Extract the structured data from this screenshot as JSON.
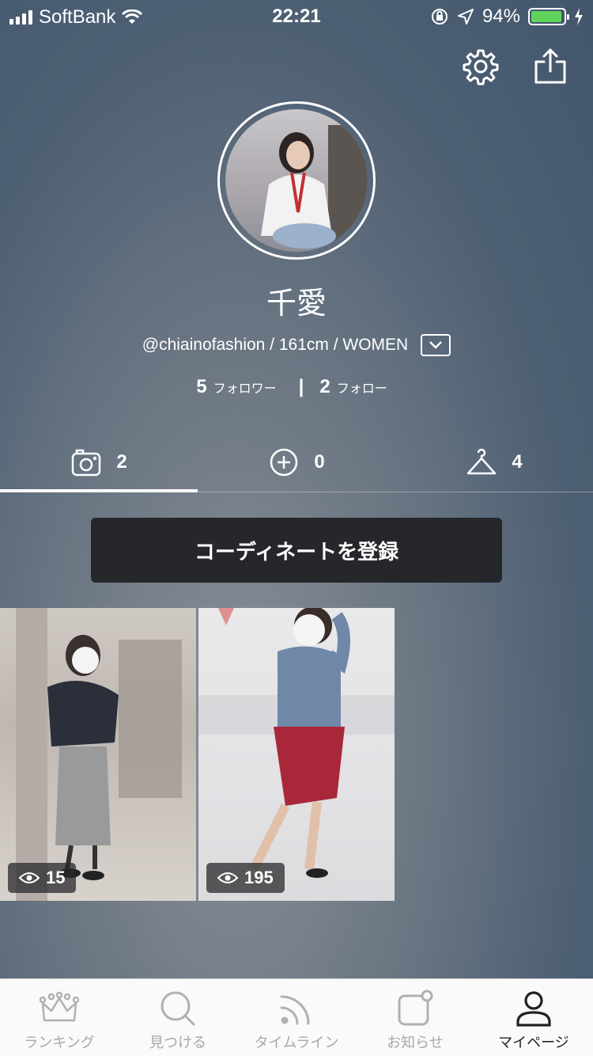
{
  "status_bar": {
    "carrier": "SoftBank",
    "time": "22:21",
    "battery": "94%",
    "battery_level": 0.94,
    "battery_color": "#5fd35a"
  },
  "header": {
    "settings_icon": "gear-icon",
    "share_icon": "share-icon"
  },
  "profile": {
    "name": "千愛",
    "meta": "@chiainofashion / 161cm / WOMEN",
    "followers_count": "5",
    "followers_label": "フォロワー",
    "following_count": "2",
    "following_label": "フォロー",
    "separator": "|"
  },
  "tabs": [
    {
      "icon": "camera-icon",
      "count": "2"
    },
    {
      "icon": "plus-circle-icon",
      "count": "0"
    },
    {
      "icon": "hanger-icon",
      "count": "4"
    }
  ],
  "register_button": "コーディネートを登録",
  "posts": [
    {
      "views": "15"
    },
    {
      "views": "195"
    }
  ],
  "tab_bar": [
    {
      "label": "ランキング",
      "icon": "crown-icon"
    },
    {
      "label": "見つける",
      "icon": "search-icon"
    },
    {
      "label": "タイムライン",
      "icon": "rss-icon"
    },
    {
      "label": "お知らせ",
      "icon": "notification-icon"
    },
    {
      "label": "マイページ",
      "icon": "user-icon"
    }
  ]
}
